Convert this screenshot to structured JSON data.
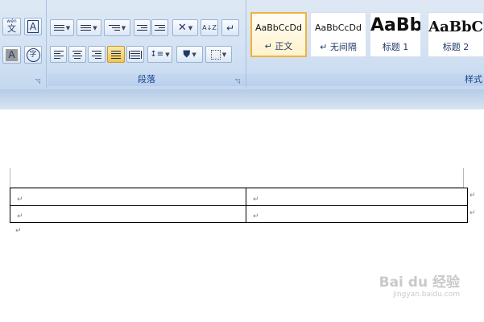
{
  "font_group": {
    "phonetic_button": "wén",
    "phonetic_char": "文",
    "char_border_button": "A",
    "char_shading_button": "A",
    "enclose_char_button": "字"
  },
  "paragraph_group": {
    "label": "段落",
    "sort_button": "A↓Z"
  },
  "styles_group": {
    "label": "样式",
    "styles": [
      {
        "sample": "AaBbCcDd",
        "name": "正文",
        "selected": true
      },
      {
        "sample": "AaBbCcDd",
        "name": "无间隔",
        "selected": false
      },
      {
        "sample": "AaBb",
        "name": "标题 1",
        "selected": false
      },
      {
        "sample": "AaBbC",
        "name": "标题 2",
        "selected": false
      }
    ]
  },
  "document": {
    "return_mark": "↵"
  },
  "watermark": {
    "logo": "Bai du 经验",
    "url": "jingyan.baidu.com"
  }
}
